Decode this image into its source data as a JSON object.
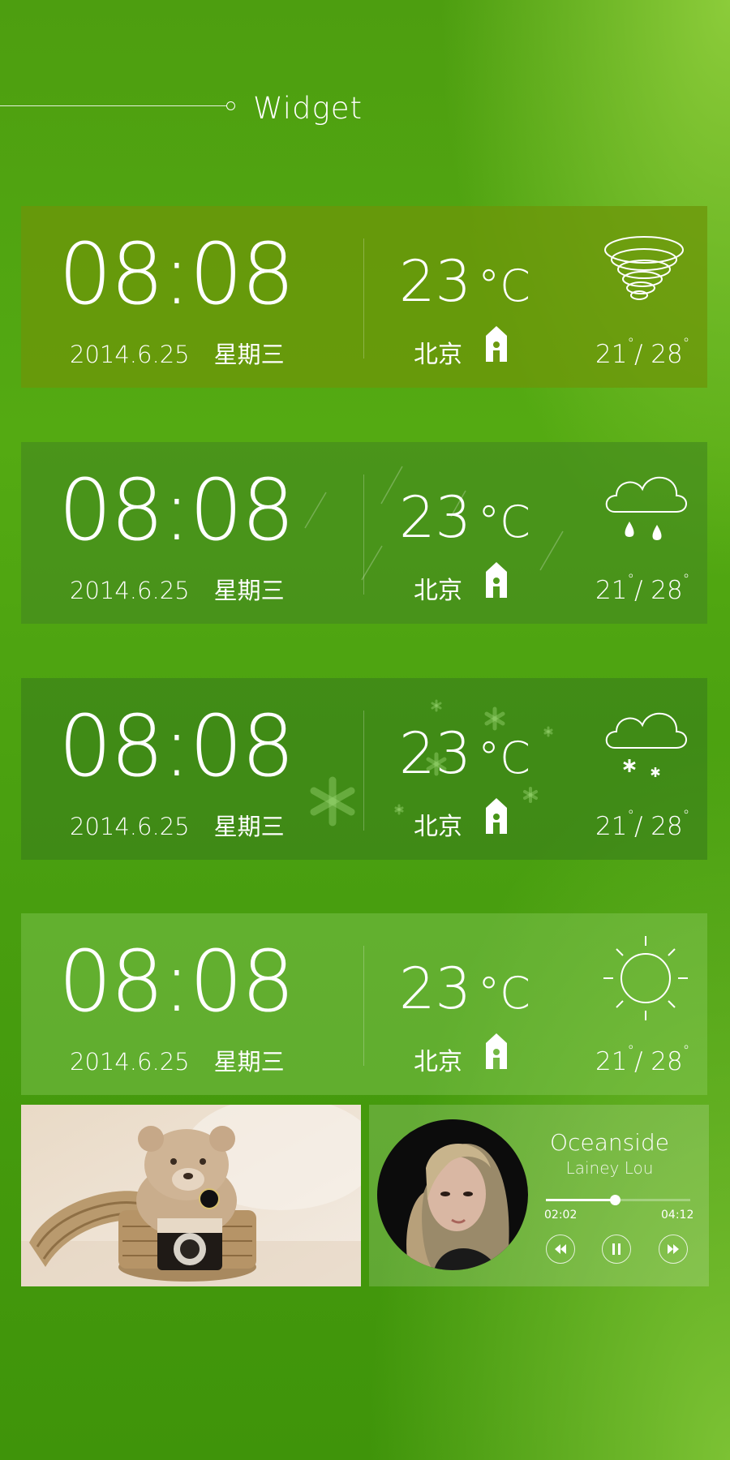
{
  "header": {
    "title": "Widget"
  },
  "cards": [
    {
      "time": "08:08",
      "date": "2014.6.25",
      "weekday": "星期三",
      "temp": "23",
      "unit": "°C",
      "city": "北京",
      "low": "21",
      "high": "28",
      "weather_icon": "tornado-icon"
    },
    {
      "time": "08:08",
      "date": "2014.6.25",
      "weekday": "星期三",
      "temp": "23",
      "unit": "°C",
      "city": "北京",
      "low": "21",
      "high": "28",
      "weather_icon": "rain-cloud-icon"
    },
    {
      "time": "08:08",
      "date": "2014.6.25",
      "weekday": "星期三",
      "temp": "23",
      "unit": "°C",
      "city": "北京",
      "low": "21",
      "high": "28",
      "weather_icon": "snow-cloud-icon"
    },
    {
      "time": "08:08",
      "date": "2014.6.25",
      "weekday": "星期三",
      "temp": "23",
      "unit": "°C",
      "city": "北京",
      "low": "21",
      "high": "28",
      "weather_icon": "sun-icon"
    }
  ],
  "music": {
    "title": "Oceanside",
    "artist": "Lainey Lou",
    "current_time": "02:02",
    "total_time": "04:12",
    "progress": 0.48,
    "controls": [
      "rewind-icon",
      "pause-icon",
      "fast-forward-icon"
    ]
  },
  "colors": {
    "card1_bg": "#6d9a10",
    "card2_bg": "#4f9a1c",
    "card3_bg": "#479418",
    "card4_bg": "#74b844"
  }
}
